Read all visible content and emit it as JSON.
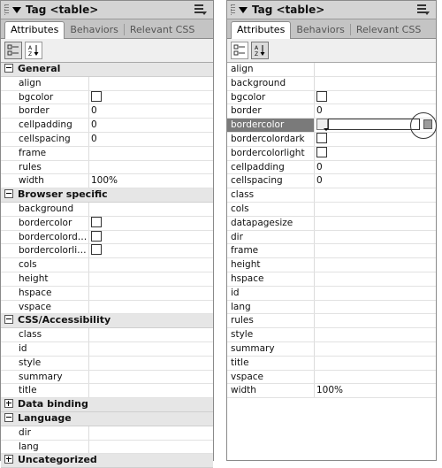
{
  "left_panel": {
    "title": "Tag <table>",
    "tabs": [
      "Attributes",
      "Behaviors",
      "Relevant CSS"
    ],
    "rows": [
      {
        "type": "cat",
        "expanded": true,
        "label": "General"
      },
      {
        "name": "align",
        "value": ""
      },
      {
        "name": "bgcolor",
        "value": "",
        "swatch": true
      },
      {
        "name": "border",
        "value": "0"
      },
      {
        "name": "cellpadding",
        "value": "0"
      },
      {
        "name": "cellspacing",
        "value": "0"
      },
      {
        "name": "frame",
        "value": ""
      },
      {
        "name": "rules",
        "value": ""
      },
      {
        "name": "width",
        "value": "100%"
      },
      {
        "type": "cat",
        "expanded": true,
        "label": "Browser specific"
      },
      {
        "name": "background",
        "value": ""
      },
      {
        "name": "bordercolor",
        "value": "",
        "swatch": true
      },
      {
        "name": "bordercolorda...",
        "value": "",
        "swatch": true
      },
      {
        "name": "bordercolorlig...",
        "value": "",
        "swatch": true
      },
      {
        "name": "cols",
        "value": ""
      },
      {
        "name": "height",
        "value": ""
      },
      {
        "name": "hspace",
        "value": ""
      },
      {
        "name": "vspace",
        "value": ""
      },
      {
        "type": "cat",
        "expanded": true,
        "label": "CSS/Accessibility"
      },
      {
        "name": "class",
        "value": ""
      },
      {
        "name": "id",
        "value": ""
      },
      {
        "name": "style",
        "value": ""
      },
      {
        "name": "summary",
        "value": ""
      },
      {
        "name": "title",
        "value": ""
      },
      {
        "type": "cat",
        "expanded": false,
        "label": "Data binding"
      },
      {
        "type": "cat",
        "expanded": true,
        "label": "Language"
      },
      {
        "name": "dir",
        "value": ""
      },
      {
        "name": "lang",
        "value": ""
      },
      {
        "type": "cat",
        "expanded": false,
        "label": "Uncategorized"
      }
    ]
  },
  "right_panel": {
    "title": "Tag <table>",
    "tabs": [
      "Attributes",
      "Behaviors",
      "Relevant CSS"
    ],
    "rows": [
      {
        "name": "align",
        "value": ""
      },
      {
        "name": "background",
        "value": ""
      },
      {
        "name": "bgcolor",
        "value": "",
        "swatch": true
      },
      {
        "name": "border",
        "value": "0"
      },
      {
        "name": "bordercolor",
        "value": "",
        "selected": true
      },
      {
        "name": "bordercolordark",
        "value": "",
        "swatch": true
      },
      {
        "name": "bordercolorlight",
        "value": "",
        "swatch": true
      },
      {
        "name": "cellpadding",
        "value": "0"
      },
      {
        "name": "cellspacing",
        "value": "0"
      },
      {
        "name": "class",
        "value": ""
      },
      {
        "name": "cols",
        "value": ""
      },
      {
        "name": "datapagesize",
        "value": ""
      },
      {
        "name": "dir",
        "value": ""
      },
      {
        "name": "frame",
        "value": ""
      },
      {
        "name": "height",
        "value": ""
      },
      {
        "name": "hspace",
        "value": ""
      },
      {
        "name": "id",
        "value": ""
      },
      {
        "name": "lang",
        "value": ""
      },
      {
        "name": "rules",
        "value": ""
      },
      {
        "name": "style",
        "value": ""
      },
      {
        "name": "summary",
        "value": ""
      },
      {
        "name": "title",
        "value": ""
      },
      {
        "name": "vspace",
        "value": ""
      },
      {
        "name": "width",
        "value": "100%"
      }
    ]
  }
}
